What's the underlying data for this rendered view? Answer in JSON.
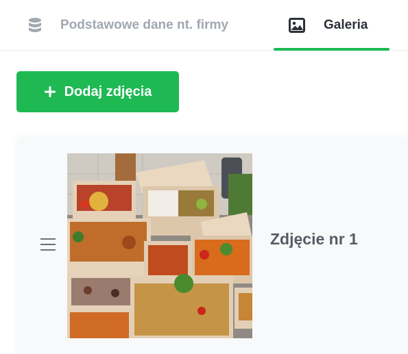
{
  "tabs": [
    {
      "label": "Podstawowe dane nt. firmy",
      "icon": "database-icon",
      "active": false
    },
    {
      "label": "Galeria",
      "icon": "image-icon",
      "active": true
    }
  ],
  "add_button": {
    "label": "Dodaj zdjęcia",
    "icon": "plus-icon"
  },
  "gallery": {
    "items": [
      {
        "caption": "Zdjęcie nr 1",
        "handle_icon": "drag-handle-icon"
      }
    ]
  },
  "colors": {
    "accent": "#1db954",
    "tab_inactive": "#a2a8b0",
    "tab_active": "#2c3138",
    "card_background": "#f8f9fa",
    "caption": "#565c65"
  }
}
